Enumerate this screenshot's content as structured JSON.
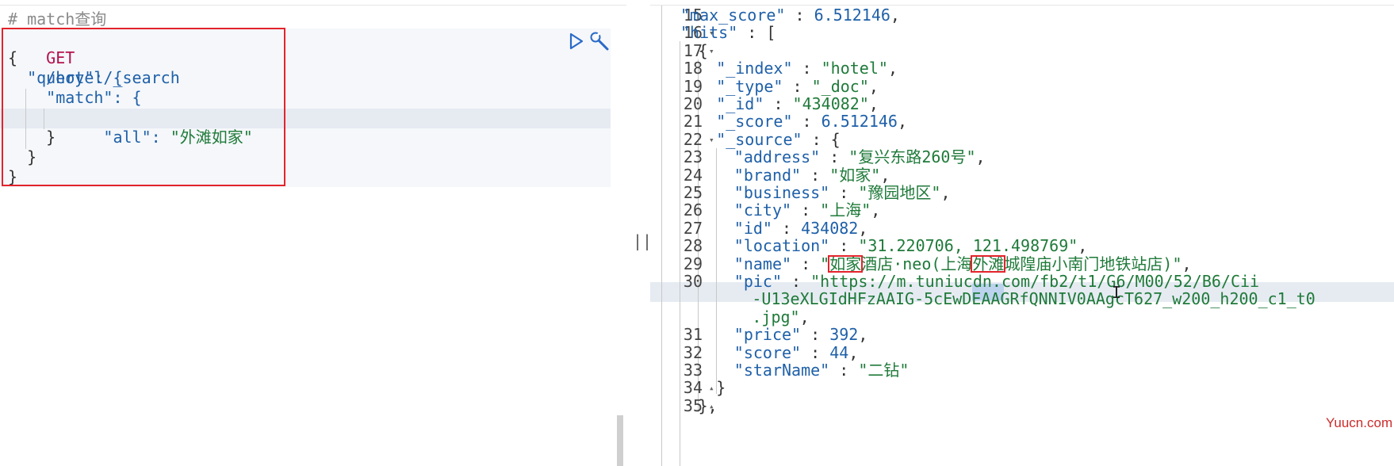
{
  "request_editor": {
    "comment": "# match查询",
    "method": "GET",
    "path": "/hotel/_search",
    "lines": [
      "{",
      "  \"query\": {",
      "    \"match\": {",
      "      \"all\": ",
      "\"外滩如家\"",
      "    }",
      "  }",
      "}"
    ],
    "run_icon": "play-icon",
    "wrench_icon": "wrench-icon"
  },
  "splitter": {
    "handle": "||"
  },
  "response_viewer": {
    "rows": [
      {
        "ln": "15",
        "fold": "",
        "indent": 2,
        "parts": [
          [
            "k",
            "\"max_score\""
          ],
          [
            "p",
            " : "
          ],
          [
            "n",
            "6.512146"
          ],
          [
            "p",
            ","
          ]
        ]
      },
      {
        "ln": "16",
        "fold": "▾",
        "indent": 2,
        "parts": [
          [
            "k",
            "\"hits\""
          ],
          [
            "p",
            " : ["
          ]
        ]
      },
      {
        "ln": "17",
        "fold": "▾",
        "indent": 3,
        "parts": [
          [
            "p",
            "{"
          ]
        ]
      },
      {
        "ln": "18",
        "fold": "",
        "indent": 4,
        "parts": [
          [
            "k",
            "\"_index\""
          ],
          [
            "p",
            " : "
          ],
          [
            "s",
            "\"hotel\""
          ],
          [
            "p",
            ","
          ]
        ]
      },
      {
        "ln": "19",
        "fold": "",
        "indent": 4,
        "parts": [
          [
            "k",
            "\"_type\""
          ],
          [
            "p",
            " : "
          ],
          [
            "s",
            "\"_doc\""
          ],
          [
            "p",
            ","
          ]
        ]
      },
      {
        "ln": "20",
        "fold": "",
        "indent": 4,
        "parts": [
          [
            "k",
            "\"_id\""
          ],
          [
            "p",
            " : "
          ],
          [
            "s",
            "\"434082\""
          ],
          [
            "p",
            ","
          ]
        ]
      },
      {
        "ln": "21",
        "fold": "",
        "indent": 4,
        "parts": [
          [
            "k",
            "\"_score\""
          ],
          [
            "p",
            " : "
          ],
          [
            "n",
            "6.512146"
          ],
          [
            "p",
            ","
          ]
        ]
      },
      {
        "ln": "22",
        "fold": "▾",
        "indent": 4,
        "parts": [
          [
            "k",
            "\"_source\""
          ],
          [
            "p",
            " : {"
          ]
        ]
      },
      {
        "ln": "23",
        "fold": "",
        "indent": 5,
        "parts": [
          [
            "k",
            "\"address\""
          ],
          [
            "p",
            " : "
          ],
          [
            "s",
            "\"复兴东路260号\""
          ],
          [
            "p",
            ","
          ]
        ]
      },
      {
        "ln": "24",
        "fold": "",
        "indent": 5,
        "parts": [
          [
            "k",
            "\"brand\""
          ],
          [
            "p",
            " : "
          ],
          [
            "s",
            "\"如家\""
          ],
          [
            "p",
            ","
          ]
        ]
      },
      {
        "ln": "25",
        "fold": "",
        "indent": 5,
        "parts": [
          [
            "k",
            "\"business\""
          ],
          [
            "p",
            " : "
          ],
          [
            "s",
            "\"豫园地区\""
          ],
          [
            "p",
            ","
          ]
        ]
      },
      {
        "ln": "26",
        "fold": "",
        "indent": 5,
        "parts": [
          [
            "k",
            "\"city\""
          ],
          [
            "p",
            " : "
          ],
          [
            "s",
            "\"上海\""
          ],
          [
            "p",
            ","
          ]
        ]
      },
      {
        "ln": "27",
        "fold": "",
        "indent": 5,
        "parts": [
          [
            "k",
            "\"id\""
          ],
          [
            "p",
            " : "
          ],
          [
            "n",
            "434082"
          ],
          [
            "p",
            ","
          ]
        ]
      },
      {
        "ln": "28",
        "fold": "",
        "indent": 5,
        "parts": [
          [
            "k",
            "\"location\""
          ],
          [
            "p",
            " : "
          ],
          [
            "s",
            "\"31.220706, 121.498769\""
          ],
          [
            "p",
            ","
          ]
        ]
      },
      {
        "ln": "29",
        "fold": "",
        "indent": 5,
        "parts": [
          [
            "k",
            "\"name\""
          ],
          [
            "p",
            " : "
          ],
          [
            "s",
            "\""
          ],
          [
            "s",
            "如家"
          ],
          [
            "s",
            "酒店·neo(上海"
          ],
          [
            "s",
            "外滩"
          ],
          [
            "s",
            "城隍庙小南门地铁站店)\""
          ],
          [
            "p",
            ","
          ]
        ]
      },
      {
        "ln": "30",
        "fold": "",
        "indent": 5,
        "parts": [
          [
            "k",
            "\"pic\""
          ],
          [
            "p",
            " : "
          ],
          [
            "s",
            "\"https://m.tuniucdn.com/fb2/t1/G6/M00/52/B6/Cii"
          ]
        ]
      },
      {
        "ln": "",
        "fold": "",
        "indent": 6,
        "parts": [
          [
            "s",
            "-U13eXLGIdHFzAAIG-5cEwDEAAGRfQNNIV0AAgcT627_w200_h200_c1_t0"
          ]
        ]
      },
      {
        "ln": "",
        "fold": "",
        "indent": 6,
        "parts": [
          [
            "s",
            ".jpg\""
          ],
          [
            "p",
            ","
          ]
        ]
      },
      {
        "ln": "31",
        "fold": "",
        "indent": 5,
        "parts": [
          [
            "k",
            "\"price\""
          ],
          [
            "p",
            " : "
          ],
          [
            "n",
            "392"
          ],
          [
            "p",
            ","
          ]
        ]
      },
      {
        "ln": "32",
        "fold": "",
        "indent": 5,
        "parts": [
          [
            "k",
            "\"score\""
          ],
          [
            "p",
            " : "
          ],
          [
            "n",
            "44"
          ],
          [
            "p",
            ","
          ]
        ]
      },
      {
        "ln": "33",
        "fold": "",
        "indent": 5,
        "parts": [
          [
            "k",
            "\"starName\""
          ],
          [
            "p",
            " : "
          ],
          [
            "s",
            "\"二钻\""
          ]
        ]
      },
      {
        "ln": "34",
        "fold": "▴",
        "indent": 4,
        "parts": [
          [
            "p",
            "}"
          ]
        ]
      },
      {
        "ln": "35",
        "fold": "▴",
        "indent": 3,
        "parts": [
          [
            "p",
            "},"
          ]
        ]
      }
    ],
    "watermark": "Yuucn.com"
  },
  "colors": {
    "highlight_border": "#e3232c",
    "key": "#1f60a8",
    "string": "#1f7a3a",
    "method": "#b5114e"
  }
}
